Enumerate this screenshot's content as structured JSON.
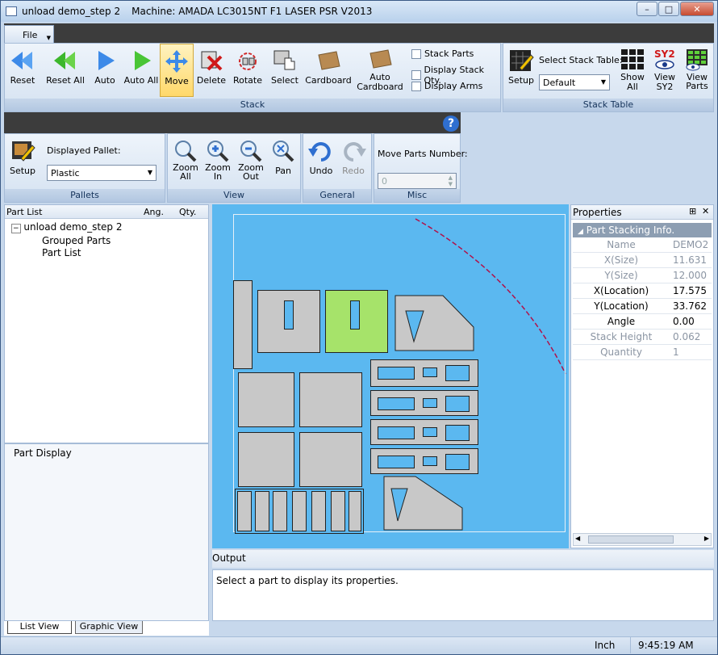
{
  "window": {
    "title": "unload demo_step 2",
    "machine": "Machine: AMADA LC3015NT F1 LASER PSR V2013",
    "min": "–",
    "max": "□",
    "close": "✕"
  },
  "menu": {
    "file": "File"
  },
  "stack_group": {
    "label": "Stack",
    "buttons": [
      {
        "label": "Reset",
        "icon": "double-left-arrow-icon"
      },
      {
        "label": "Reset All",
        "icon": "double-left-green-arrow-icon"
      },
      {
        "label": "Auto",
        "icon": "right-arrow-icon"
      },
      {
        "label": "Auto All",
        "icon": "right-green-arrow-icon"
      },
      {
        "label": "Move",
        "icon": "move-cross-icon"
      },
      {
        "label": "Delete",
        "icon": "delete-icon"
      },
      {
        "label": "Rotate",
        "icon": "rotate-icon"
      },
      {
        "label": "Select",
        "icon": "select-hand-icon"
      },
      {
        "label": "Cardboard",
        "icon": "cardboard-icon"
      },
      {
        "label": "Auto Cardboard",
        "icon": "auto-cardboard-icon"
      }
    ],
    "checks": [
      "Stack Parts",
      "Display Stack Qty.",
      "Display Arms"
    ]
  },
  "stack_table_group": {
    "label": "Stack Table",
    "setup": "Setup",
    "select_label": "Select Stack Table:",
    "select_value": "Default",
    "show_all": "Show All",
    "view_sy2": "View SY2",
    "view_parts": "View Parts",
    "sy2_badge": "SY2"
  },
  "pallets_group": {
    "label": "Pallets",
    "setup": "Setup",
    "displayed_pallet_label": "Displayed Pallet:",
    "pallet_value": "Plastic"
  },
  "view_group": {
    "label": "View",
    "zoom_all": "Zoom All",
    "zoom_in": "Zoom In",
    "zoom_out": "Zoom Out",
    "pan": "Pan"
  },
  "general_group": {
    "label": "General",
    "undo": "Undo",
    "redo": "Redo"
  },
  "misc_group": {
    "label": "Misc",
    "move_parts_label": "Move Parts Number:",
    "move_parts_value": "0"
  },
  "help": "?",
  "part_list": {
    "header": "Part List",
    "col_ang": "Ang.",
    "col_qty": "Qty.",
    "root": "unload demo_step 2",
    "children": [
      "Grouped Parts",
      "Part List"
    ]
  },
  "part_display": {
    "header": "Part Display"
  },
  "tabs": {
    "list_view": "List View",
    "graphic_view": "Graphic View"
  },
  "properties": {
    "header": "Properties",
    "pin": "⊞",
    "close": "✕",
    "section": "Part Stacking Info.",
    "rows": [
      {
        "k": "Name",
        "v": "DEMO2",
        "ro": true
      },
      {
        "k": "X(Size)",
        "v": "11.631",
        "ro": true
      },
      {
        "k": "Y(Size)",
        "v": "12.000",
        "ro": true
      },
      {
        "k": "X(Location)",
        "v": "17.575",
        "ro": false
      },
      {
        "k": "Y(Location)",
        "v": "33.762",
        "ro": false
      },
      {
        "k": "Angle",
        "v": "0.00",
        "ro": false
      },
      {
        "k": "Stack Height",
        "v": "0.062",
        "ro": true
      },
      {
        "k": "Quantity",
        "v": "1",
        "ro": true
      }
    ]
  },
  "output": {
    "header": "Output",
    "message": "Select a part to display its properties."
  },
  "status": {
    "units": "Inch",
    "time": "9:45:19 AM"
  },
  "colors": {
    "accent": "#2f6fd0",
    "canvas": "#5bb8f0",
    "selected_part": "#a6e36a"
  }
}
